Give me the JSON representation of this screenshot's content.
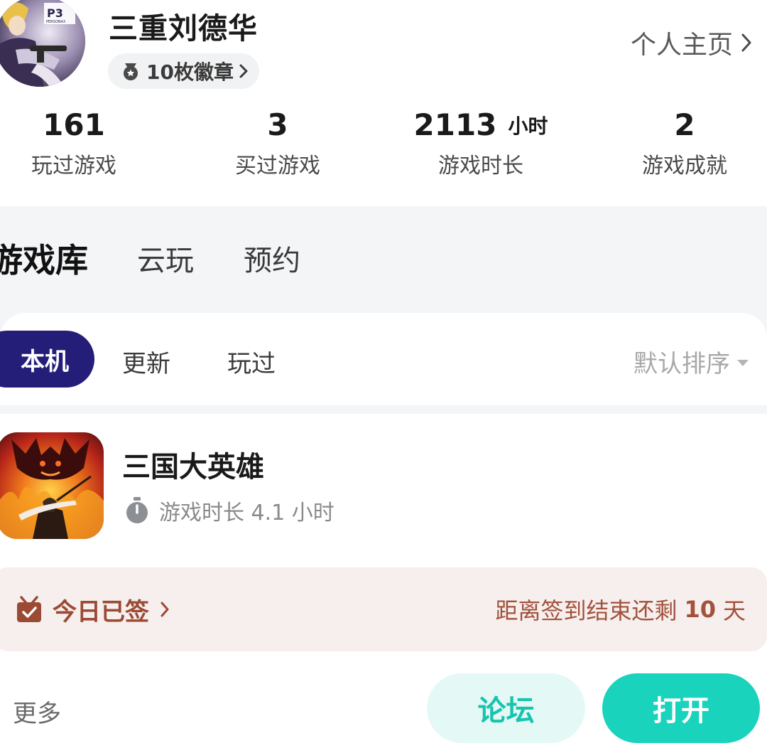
{
  "profile": {
    "username": "三重刘德华",
    "badges_label": "10枚徽章",
    "profile_link_label": "个人主页",
    "avatar_text": "P3 PERSONA3"
  },
  "stats": [
    {
      "value": "161",
      "unit": "",
      "label": "玩过游戏"
    },
    {
      "value": "3",
      "unit": "",
      "label": "买过游戏"
    },
    {
      "value": "2113",
      "unit": "小时",
      "label": "游戏时长"
    },
    {
      "value": "2",
      "unit": "",
      "label": "游戏成就"
    }
  ],
  "main_tabs": [
    {
      "label": "游戏库",
      "active": true
    },
    {
      "label": "云玩",
      "active": false
    },
    {
      "label": "预约",
      "active": false
    }
  ],
  "filter_chips": [
    {
      "label": "本机",
      "active": true
    },
    {
      "label": "更新",
      "active": false
    },
    {
      "label": "玩过",
      "active": false
    }
  ],
  "sort": {
    "label": "默认排序"
  },
  "game": {
    "title": "三国大英雄",
    "playtime": "游戏时长 4.1 小时"
  },
  "checkin": {
    "status_label": "今日已签",
    "remaining_prefix": "距离签到结束还剩",
    "remaining_days": "10",
    "remaining_suffix": "天"
  },
  "actions": {
    "more_label": "更多",
    "forum_label": "论坛",
    "open_label": "打开"
  },
  "colors": {
    "accent_teal": "#19d3bc",
    "chip_active_bg": "#241e78",
    "checkin_bg": "#f6efed",
    "checkin_text": "#9b4a33"
  }
}
